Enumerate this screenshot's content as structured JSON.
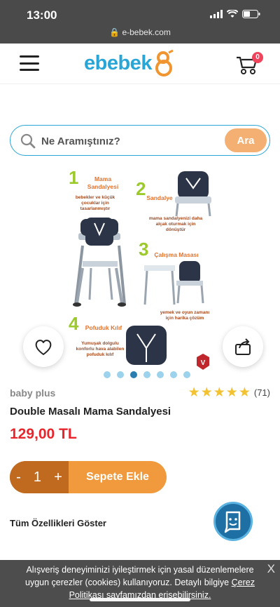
{
  "status_bar": {
    "time": "13:00",
    "url": "e-bebek.com"
  },
  "header": {
    "logo_text": "ebebek",
    "cart_count": "0"
  },
  "search": {
    "placeholder": "Ne Aramıştınız?",
    "button_label": "Ara"
  },
  "gallery": {
    "steps": [
      {
        "number": "1",
        "title": "Mama Sandalyesi",
        "desc": "bebekler ve küçük çocuklar için tasarlanmıştır"
      },
      {
        "number": "2",
        "title": "Sandalye",
        "desc": "mama sandalyenizi daha alçak oturmak için dönüştür"
      },
      {
        "number": "3",
        "title": "Çalışma Masası",
        "desc": "yemek ve oyun zamanı için harika çözüm"
      },
      {
        "number": "4",
        "title": "Pofuduk Kılıf",
        "desc": "Yumuşak dolgulu konforlu hava alabilen pofuduk kılıf"
      }
    ],
    "dot_count": 7,
    "active_dot": 3
  },
  "product": {
    "brand": "baby plus",
    "rating_count": "(71)",
    "rating_stars": 5,
    "name": "Double Masalı Mama Sandalyesi",
    "price": "129,00 TL"
  },
  "cart_control": {
    "minus": "-",
    "quantity": "1",
    "plus": "+",
    "add_label": "Sepete Ekle"
  },
  "links": {
    "all_features": "Tüm Özellikleri Göster"
  },
  "cookie_banner": {
    "text_part1": "Alışveriş deneyiminizi iyileştirmek için yasal düzenlemelere uygun çerezler (cookies) kullanıyoruz. Detaylı bilgiye ",
    "link_text": "Çerez Politikası sayfamızdan erişebilirsiniz.",
    "close": "X"
  },
  "colors": {
    "brand_blue": "#29a5d6",
    "orange": "#f09a3d",
    "price_red": "#e8252c"
  }
}
